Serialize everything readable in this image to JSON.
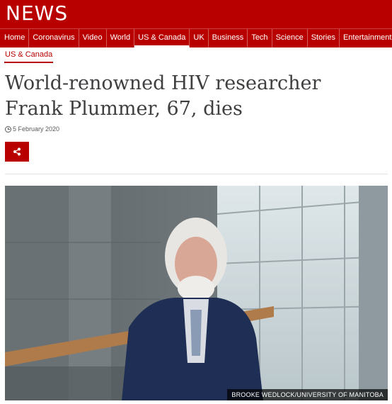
{
  "brand": {
    "logo_text": "NEWS",
    "accent": "#b80000"
  },
  "nav": {
    "items": [
      {
        "label": "Home"
      },
      {
        "label": "Coronavirus"
      },
      {
        "label": "Video"
      },
      {
        "label": "World"
      },
      {
        "label": "US & Canada",
        "active": true
      },
      {
        "label": "UK"
      },
      {
        "label": "Business"
      },
      {
        "label": "Tech"
      },
      {
        "label": "Science"
      },
      {
        "label": "Stories"
      },
      {
        "label": "Entertainment"
      }
    ]
  },
  "article": {
    "section_label": "US & Canada",
    "headline": "World-renowned HIV researcher Frank Plummer, 67, dies",
    "date": "5 February 2020",
    "share_icon": "share-icon",
    "image_caption": "BROOKE WEDLOCK/UNIVERSITY OF MANITOBA"
  }
}
